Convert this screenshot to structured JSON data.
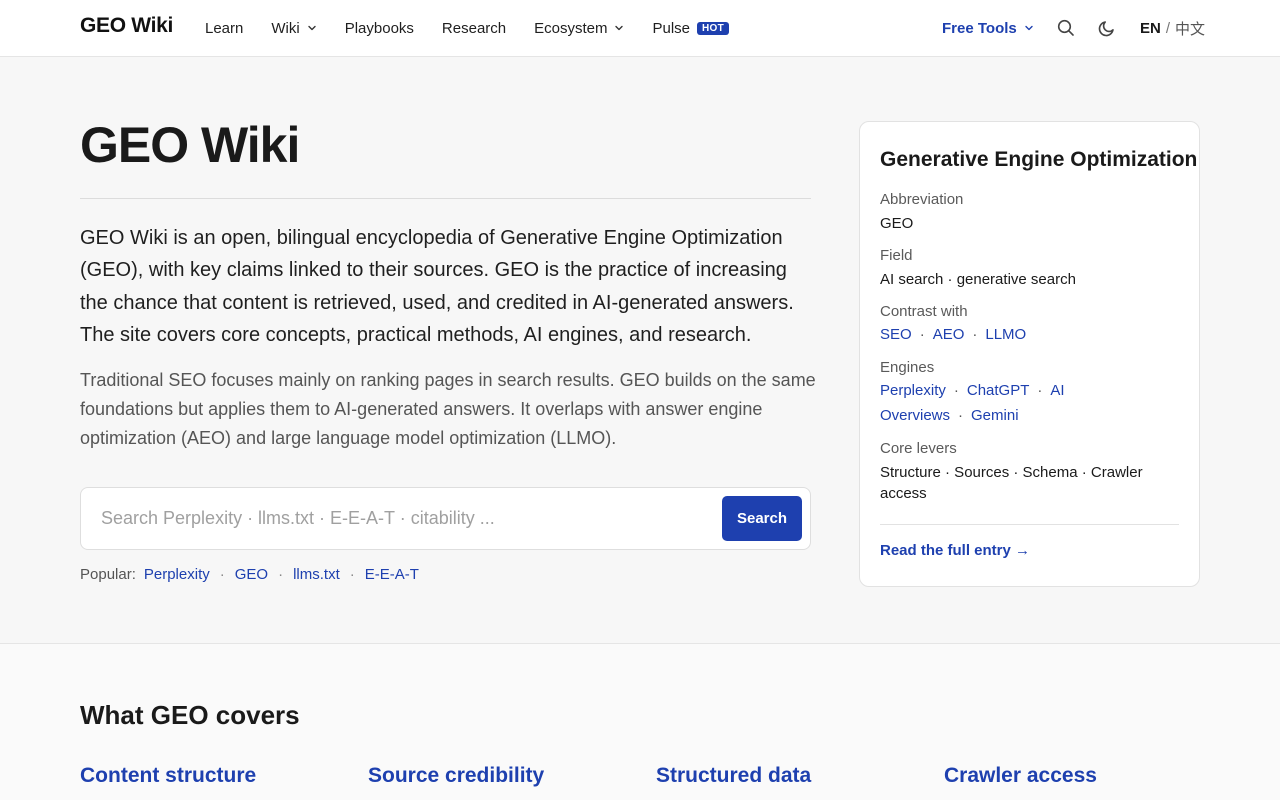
{
  "header": {
    "brand": "GEO Wiki",
    "nav": [
      {
        "label": "Learn"
      },
      {
        "label": "Wiki"
      },
      {
        "label": "Playbooks"
      },
      {
        "label": "Research"
      },
      {
        "label": "Ecosystem"
      },
      {
        "label": "Pulse",
        "badge": "HOT"
      }
    ],
    "free_tools": "Free Tools",
    "lang_active": "EN",
    "lang_sep": "/",
    "lang_other": "中文",
    "icons": [
      "search-icon",
      "moon-icon"
    ]
  },
  "hero": {
    "title": "GEO Wiki",
    "lead": "GEO Wiki is an open, bilingual encyclopedia of Generative Engine Optimization (GEO), with key claims linked to their sources. GEO is the practice of increasing the chance that content is retrieved, used, and credited in AI-generated answers. The site covers core concepts, practical methods, AI engines, and research.",
    "sub": "Traditional SEO focuses mainly on ranking pages in search results. GEO builds on the same foundations but applies them to AI-generated answers. It overlaps with answer engine optimization (AEO) and large language model optimization (LLMO)."
  },
  "search": {
    "placeholder": "Search Perplexity · llms.txt · E-E-A-T · citability ...",
    "button": "Search",
    "popular_label": "Popular:",
    "popular": [
      "Perplexity",
      "GEO",
      "llms.txt",
      "E-E-A-T"
    ],
    "separator": "·"
  },
  "infobox": {
    "title": "Generative Engine Optimization",
    "abbreviation_label": "Abbreviation",
    "abbreviation": "GEO",
    "field_label": "Field",
    "field": "AI search · generative search",
    "contrast_label": "Contrast with",
    "contrast": [
      "SEO",
      "AEO",
      "LLMO"
    ],
    "engines_label": "Engines",
    "engines": [
      "Perplexity",
      "ChatGPT",
      "AI Overviews",
      "Gemini"
    ],
    "levers_label": "Core levers",
    "levers": "Structure · Sources · Schema · Crawler access",
    "cta": "Read the full entry →"
  },
  "covers": {
    "title": "What GEO covers",
    "items": [
      "Content structure",
      "Source credibility",
      "Structured data",
      "Crawler access"
    ]
  },
  "colors": {
    "accent": "#1e40af",
    "background": "#f7f7f7",
    "text": "#1a1a1a"
  }
}
